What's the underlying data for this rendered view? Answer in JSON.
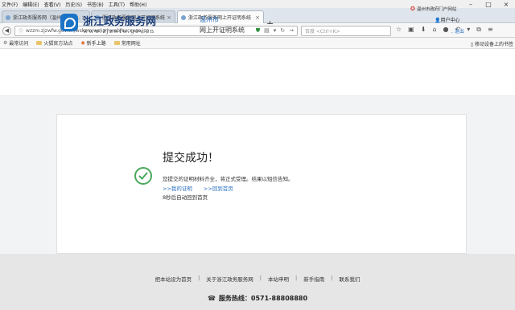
{
  "menu": [
    "文件(F)",
    "编辑(E)",
    "查看(V)",
    "历史(S)",
    "书签(B)",
    "工具(T)",
    "帮助(H)"
  ],
  "tabs": [
    {
      "label": "浙江政务服务网（温州市区海..."
    },
    {
      "label": "浙江政务服务网上开证明系统"
    },
    {
      "label": "浙江政务服务网上开证明系统"
    }
  ],
  "address": {
    "url": "wzzm.zjzwfw.gov.cn/wskzm/wskzmweb/success.jsp"
  },
  "search": {
    "placeholder": "百度 <Ctrl+K>"
  },
  "bookmarks": [
    "最常访问",
    "火狐官方站点",
    "新手上路",
    "常用网址"
  ],
  "bookmarks_right": "移动设备上的书签",
  "header": {
    "logo_cn": "浙江政务服务网",
    "logo_en": "www.zjzwfw.gov.cn",
    "city": "温州市",
    "system_name": "网上开证明系统",
    "portal_link": "温州市政府门户网站",
    "user_center": "用户中心",
    "logout": "退出"
  },
  "result": {
    "title": "提交成功！",
    "message": "您提交的证明材料齐全，将正式受理。结果以短信告知。",
    "link_my_certs": ">>我的证明",
    "link_home": ">>回到首页",
    "countdown": "8秒后自动回到首页"
  },
  "footer": {
    "links": [
      "把本站设为首页",
      "关于浙江政务服务网",
      "本站申明",
      "新手指南",
      "联系我们"
    ],
    "hotline": "服务热线：0571-88808880"
  },
  "colors": {
    "accent": "#2a6fc0",
    "success": "#4aa85a",
    "brand": "#1c3f78"
  }
}
